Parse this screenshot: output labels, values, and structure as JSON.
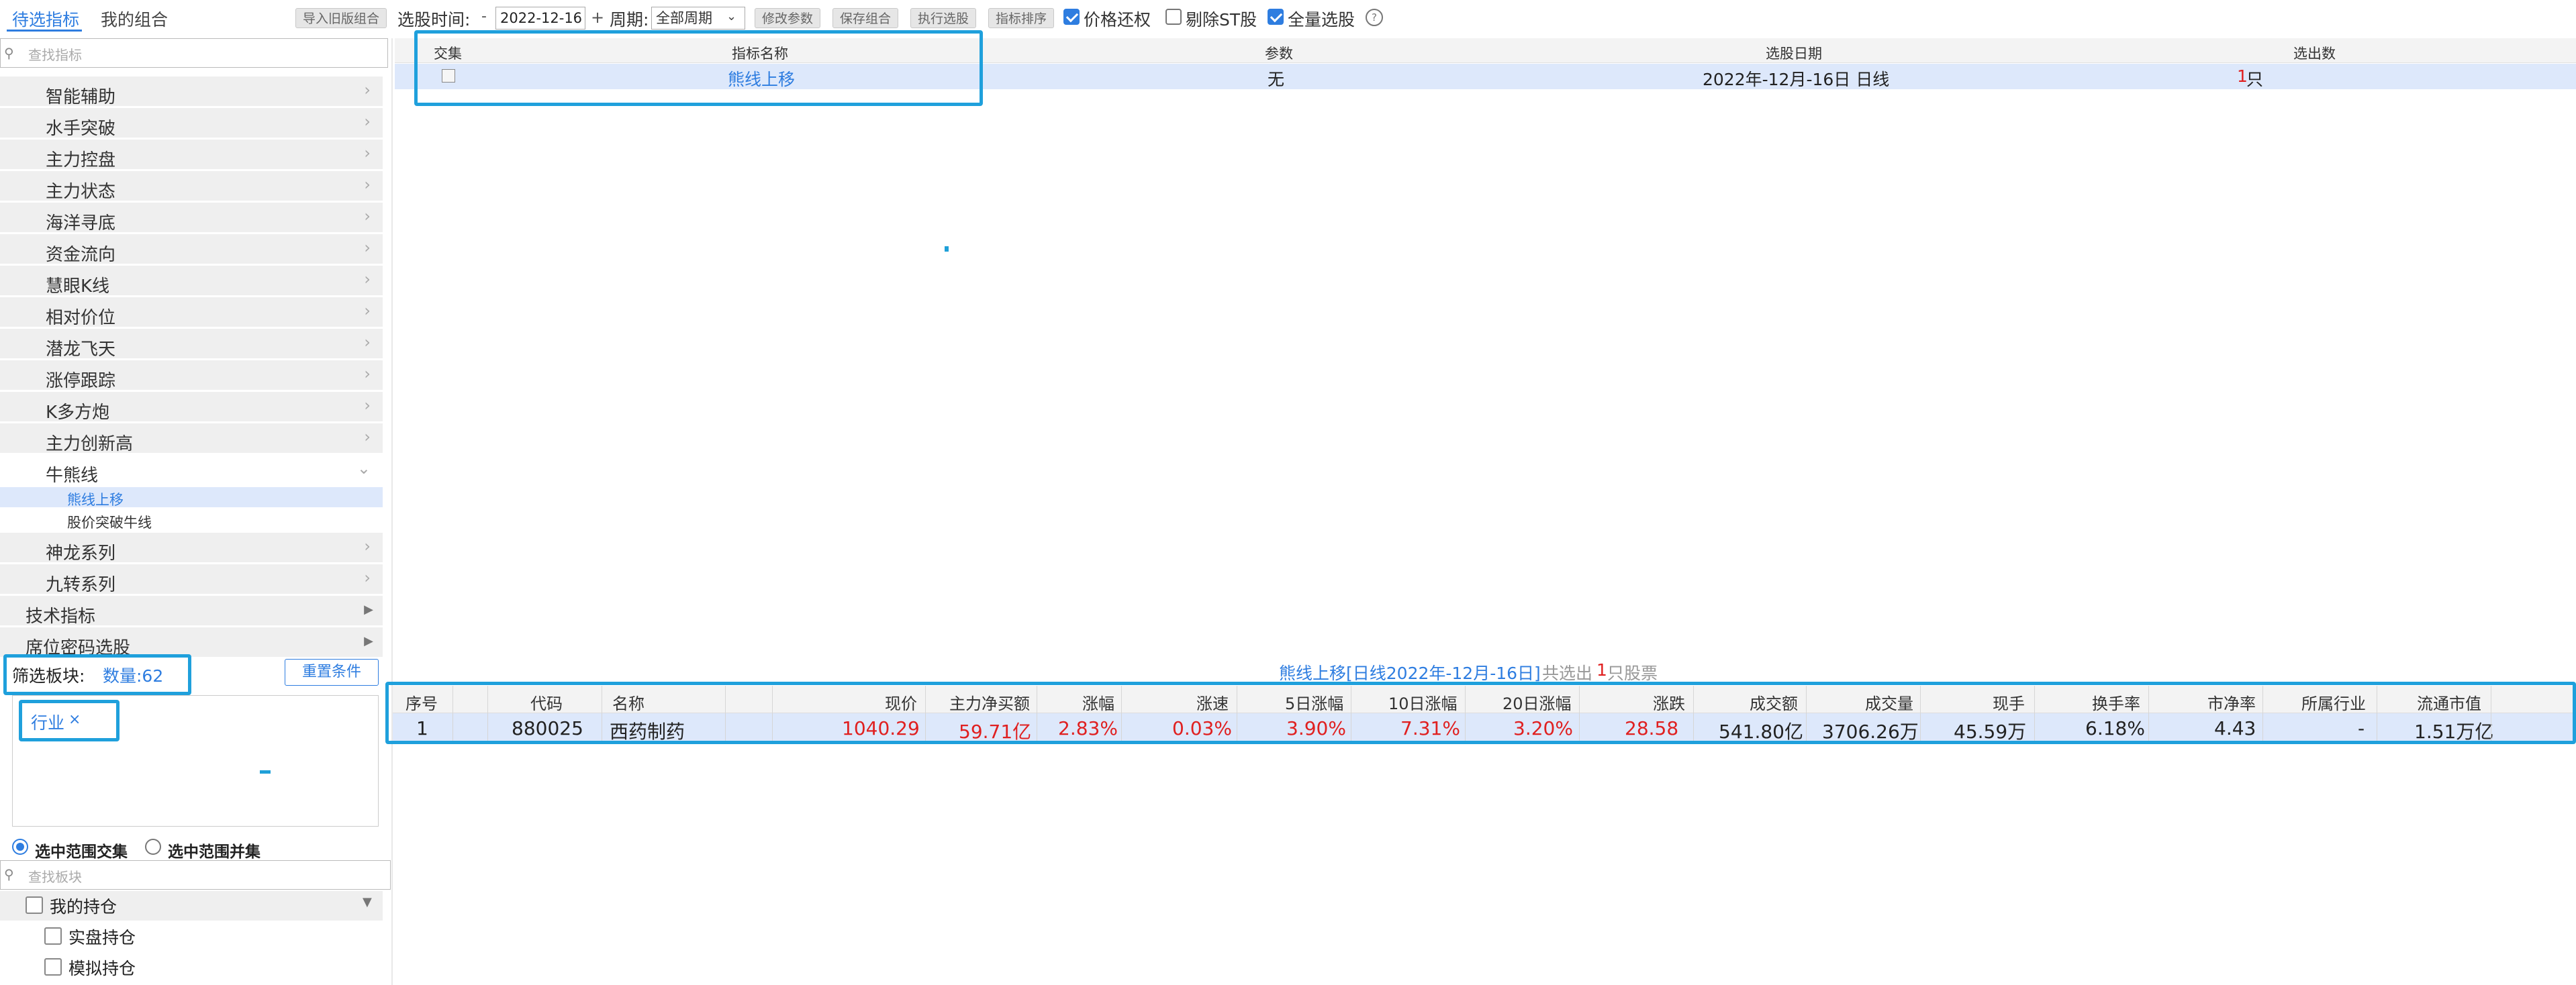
{
  "tabs": {
    "active": "待选指标",
    "other": "我的组合"
  },
  "toolbar": {
    "import_old": "导入旧版组合",
    "time_label": "选股时间:",
    "date_minus": "-",
    "date_value": "2022-12-16",
    "date_plus": "+",
    "period_label": "周期:",
    "period_value": "全部周期",
    "modify_params": "修改参数",
    "save_combo": "保存组合",
    "run_select": "执行选股",
    "indicator_sort": "指标排序",
    "price_restore": "价格还权",
    "remove_st": "剔除ST股",
    "full_select": "全量选股",
    "help": "?"
  },
  "left": {
    "search_placeholder": "查找指标",
    "menu": [
      "智能辅助",
      "水手突破",
      "主力控盘",
      "主力状态",
      "海洋寻底",
      "资金流向",
      "慧眼K线",
      "相对价位",
      "潜龙飞天",
      "涨停跟踪",
      "K多方炮",
      "主力创新高",
      "牛熊线"
    ],
    "submenu": [
      "熊线上移",
      "股价突破牛线"
    ],
    "menu2": [
      "神龙系列",
      "九转系列"
    ],
    "top_items": [
      "技术指标",
      "席位密码选股"
    ],
    "filter_label": "筛选板块:",
    "filter_count": "数量:62",
    "reset_button": "重置条件",
    "tag": "行业",
    "tag_close": "×",
    "radio_intersection": "选中范围交集",
    "radio_union": "选中范围并集",
    "block_search_placeholder": "查找板块",
    "holdings": "我的持仓",
    "holdings_real": "实盘持仓",
    "holdings_sim": "模拟持仓"
  },
  "indicator_table": {
    "headers": {
      "intersect": "交集",
      "name": "指标名称",
      "param": "参数",
      "date": "选股日期",
      "count": "选出数"
    },
    "row": {
      "name": "熊线上移",
      "param": "无",
      "date": "2022年-12月-16日 日线",
      "count": "1",
      "unit": "只"
    }
  },
  "results": {
    "title": "熊线上移[日线2022年-12月-16日]",
    "summary_prefix": "共选出",
    "summary_count": "1",
    "summary_suffix": "只股票",
    "headers": [
      "序号",
      "代码",
      "名称",
      "现价",
      "主力净买额",
      "涨幅",
      "涨速",
      "5日涨幅",
      "10日涨幅",
      "20日涨幅",
      "涨跌",
      "成交额",
      "成交量",
      "现手",
      "换手率",
      "市净率",
      "所属行业",
      "流通市值"
    ],
    "row": {
      "index": "1",
      "code": "880025",
      "name": "西药制药",
      "price": "1040.29",
      "main_net_buy": "59.71亿",
      "change_pct": "2.83%",
      "speed": "0.03%",
      "chg5": "3.90%",
      "chg10": "7.31%",
      "chg20": "3.20%",
      "change": "28.58",
      "amount": "541.80亿",
      "volume": "3706.26万",
      "current_hand": "45.59万",
      "turnover": "6.18%",
      "pb": "4.43",
      "industry": "-",
      "float_cap": "1.51万亿"
    }
  },
  "colors": {
    "accent": "#2e7de0",
    "highlight_box": "#1fa0dc",
    "selected_row": "#dde8fb",
    "up": "#e02020"
  }
}
